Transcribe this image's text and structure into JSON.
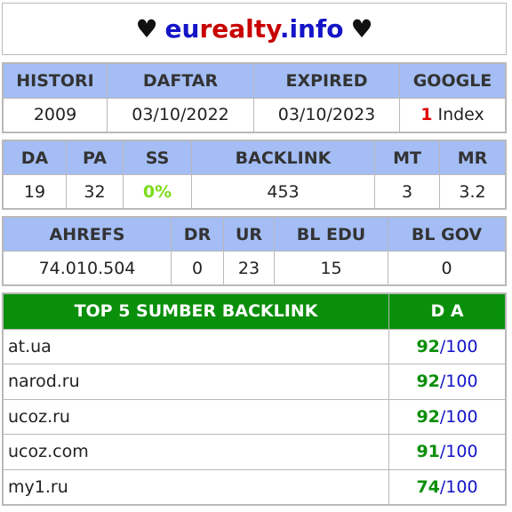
{
  "title": {
    "heart_left": "♥",
    "part1": "eu",
    "part2": "realty",
    "part3": ".info",
    "heart_right": "♥"
  },
  "t1": {
    "headers": [
      "HISTORI",
      "DAFTAR",
      "EXPIRED",
      "GOOGLE"
    ],
    "values": [
      "2009",
      "03/10/2022",
      "03/10/2023"
    ],
    "google_count": "1",
    "google_label": " Index"
  },
  "t2": {
    "headers": [
      "DA",
      "PA",
      "SS",
      "BACKLINK",
      "MT",
      "MR"
    ],
    "values": [
      "19",
      "32",
      "0%",
      "453",
      "3",
      "3.2"
    ]
  },
  "t3": {
    "headers": [
      "AHREFS",
      "DR",
      "UR",
      "BL EDU",
      "BL GOV"
    ],
    "values": [
      "74.010.504",
      "0",
      "23",
      "15",
      "0"
    ]
  },
  "sources": {
    "header_site": "TOP 5 SUMBER BACKLINK",
    "header_da": "D A",
    "rows": [
      {
        "site": "at.ua",
        "da": "92",
        "max": "100"
      },
      {
        "site": "narod.ru",
        "da": "92",
        "max": "100"
      },
      {
        "site": "ucoz.ru",
        "da": "92",
        "max": "100"
      },
      {
        "site": "ucoz.com",
        "da": "91",
        "max": "100"
      },
      {
        "site": "my1.ru",
        "da": "74",
        "max": "100"
      }
    ]
  },
  "colors": {
    "header_bg": "#a4bdf5",
    "source_header_bg": "#0a8f0a",
    "blue": "#1414c8",
    "red": "#c80000",
    "green": "#0a8f0a",
    "ss_green": "#7ddc1c"
  }
}
